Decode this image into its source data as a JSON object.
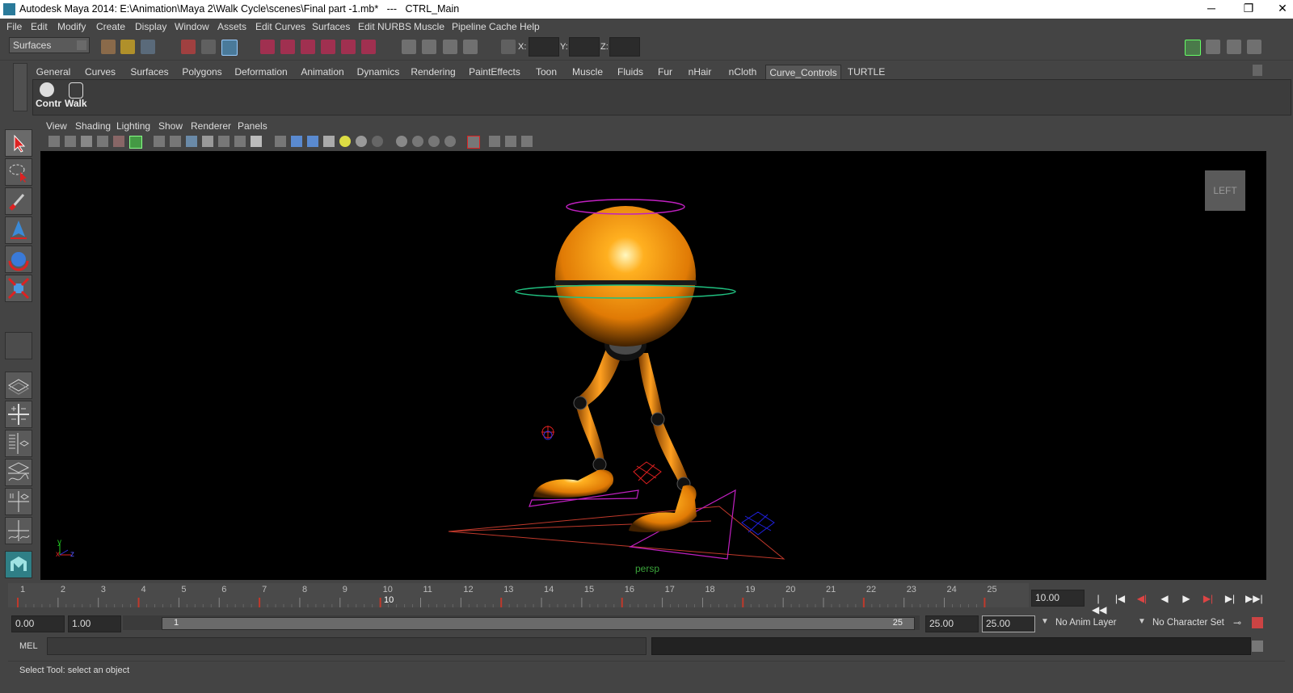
{
  "window": {
    "title": "Autodesk Maya 2014: E:\\Animation\\Maya 2\\Walk Cycle\\scenes\\Final part -1.mb*   ---   CTRL_Main",
    "minimize": "─",
    "restore": "❐",
    "close": "✕"
  },
  "menubar": [
    "File",
    "Edit",
    "Modify",
    "Create",
    "Display",
    "Window",
    "Assets",
    "Edit Curves",
    "Surfaces",
    "Edit NURBS",
    "Muscle",
    "Pipeline Cache",
    "Help"
  ],
  "statusline": {
    "menuset": "Surfaces",
    "x_label": "X:",
    "y_label": "Y:",
    "z_label": "Z:"
  },
  "shelf": {
    "tabs": [
      "General",
      "Curves",
      "Surfaces",
      "Polygons",
      "Deformation",
      "Animation",
      "Dynamics",
      "Rendering",
      "PaintEffects",
      "Toon",
      "Muscle",
      "Fluids",
      "Fur",
      "nHair",
      "nCloth",
      "Curve_Controls",
      "TURTLE"
    ],
    "active_tab": "Curve_Controls",
    "items": [
      "Contr",
      "Walk"
    ]
  },
  "panel": {
    "menus": [
      "View",
      "Shading",
      "Lighting",
      "Show",
      "Renderer",
      "Panels"
    ],
    "viewcube_label": "LEFT",
    "camera_name": "persp",
    "axis_y": "y",
    "axis_x": "x",
    "axis_z": "z"
  },
  "timeline": {
    "ticks": [
      "1",
      "2",
      "3",
      "4",
      "5",
      "6",
      "7",
      "8",
      "9",
      "10",
      "11",
      "12",
      "13",
      "14",
      "15",
      "16",
      "17",
      "18",
      "19",
      "20",
      "21",
      "22",
      "23",
      "24",
      "25"
    ],
    "current_frame_label": "10",
    "current_time": "10.00",
    "keyframes": [
      1,
      4,
      7,
      10,
      13,
      16,
      19,
      22,
      25
    ]
  },
  "range": {
    "start_time": "0.00",
    "playback_start": "1.00",
    "slider_start": "1",
    "slider_end": "25",
    "playback_end": "25.00",
    "end_time": "25.00",
    "anim_layer": "No Anim Layer",
    "character_set": "No Character Set"
  },
  "playback": {
    "go_start": "|◀◀",
    "step_back": "|◀",
    "key_back": "◀|",
    "play_back": "◀",
    "play_fwd": "▶",
    "key_fwd": "▶|",
    "step_fwd": "▶|",
    "go_end": "▶▶|"
  },
  "cmdline": {
    "label": "MEL",
    "value": ""
  },
  "helpline": {
    "text": "Select Tool: select an object"
  },
  "colors": {
    "character": "#f08a10",
    "keyframe": "#c0392b",
    "curve_magenta": "#c020c0",
    "curve_green": "#20c080",
    "camera_label": "#3aa33a"
  }
}
